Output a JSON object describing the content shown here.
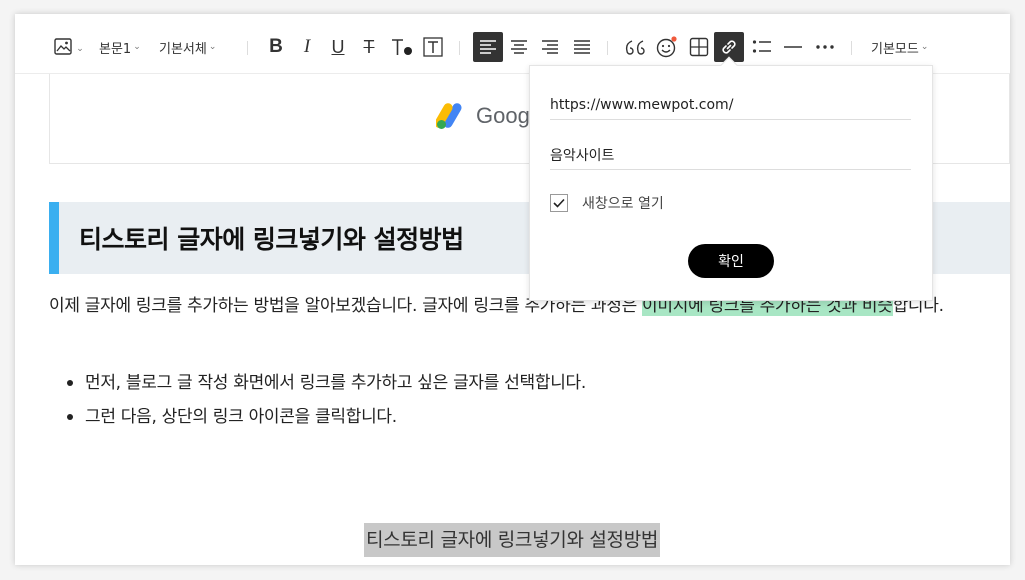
{
  "toolbar": {
    "paragraph_style": "본문1",
    "font_family": "기본서체",
    "mode": "기본모드"
  },
  "image_block": {
    "logo_text": "Goog"
  },
  "heading": "티스토리 글자에 링크넣기와 설정방법",
  "paragraph": {
    "line1_plain": "이제 글자에 링크를 추가하는 방법을 알아보겠습니다. 글자에 링크를 추가하는 과정은 ",
    "line1_highlight": "이미지에 링크를 추가하는 것과 비슷",
    "line2_plain": "합니다."
  },
  "bullets": [
    "먼저, 블로그 글 작성 화면에서 링크를 추가하고 싶은 글자를 선택합니다.",
    "그런 다음, 상단의 링크 아이콘을 클릭합니다."
  ],
  "caption": "티스토리 글자에 링크넣기와 설정방법",
  "link_popup": {
    "url_value": "https://www.mewpot.com/",
    "title_value": "음악사이트",
    "new_window_label": "새창으로 열기",
    "new_window_checked": true,
    "confirm_label": "확인"
  },
  "colors": {
    "heading_accent": "#3aaff0",
    "heading_bg": "#e9eef2",
    "highlight": "#a8e6c4",
    "caption_bg": "#c8c8c8",
    "active_button": "#333333"
  }
}
